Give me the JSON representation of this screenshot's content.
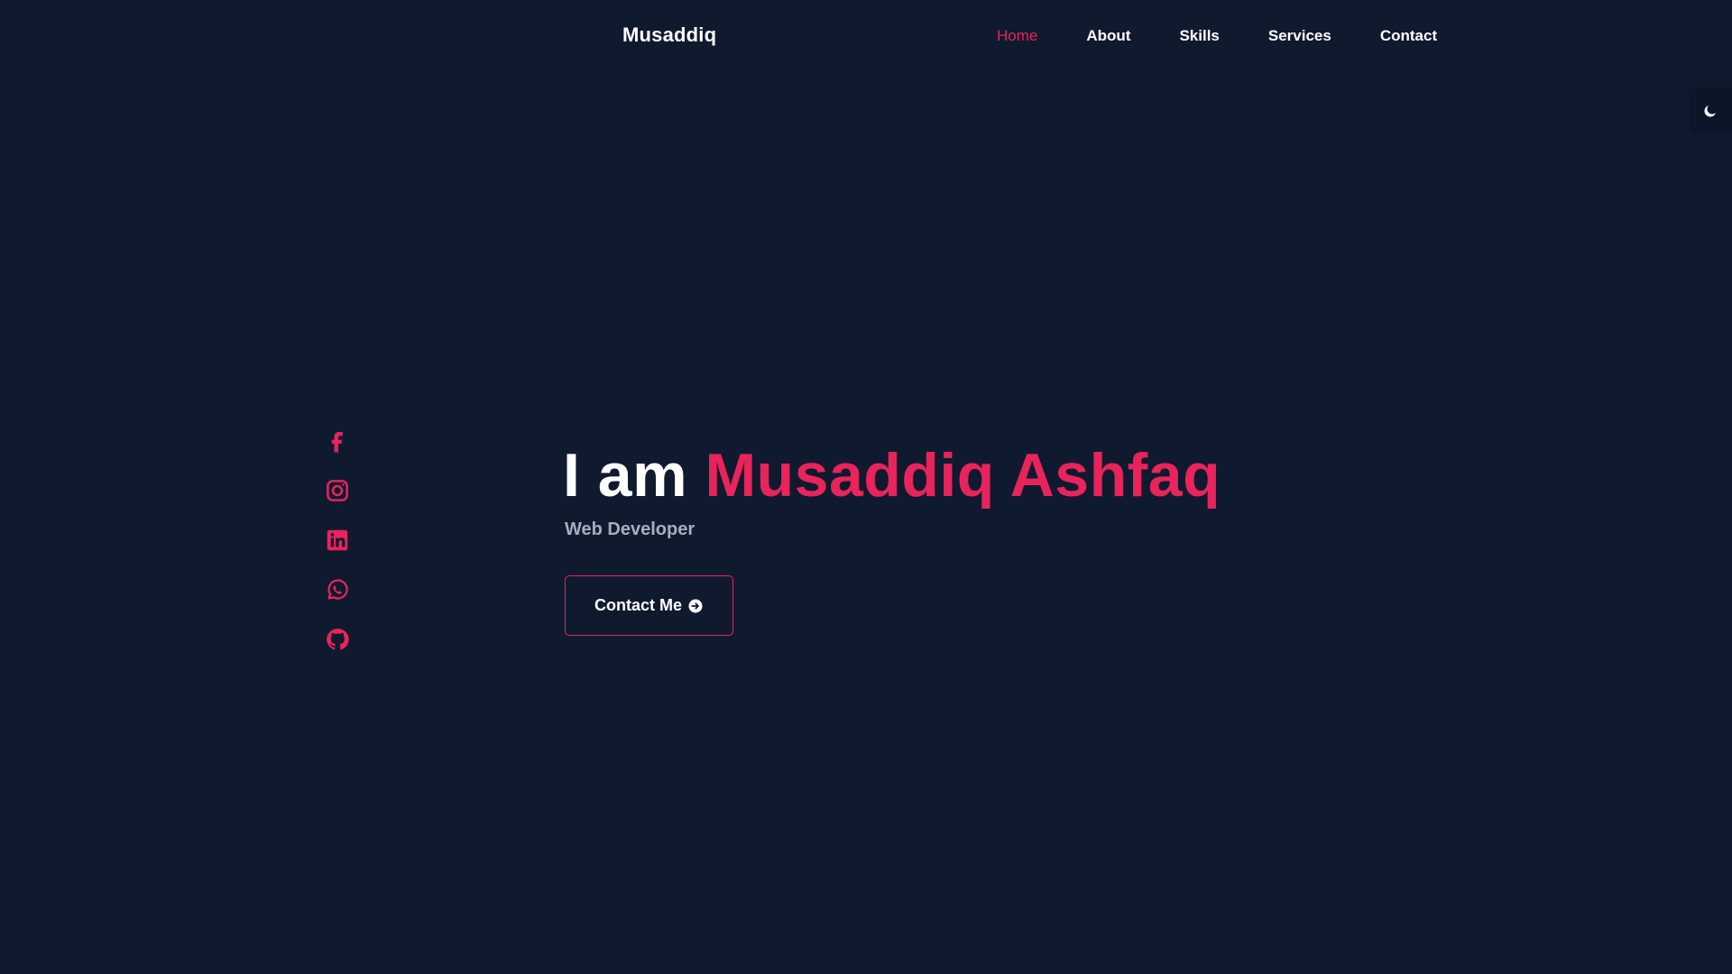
{
  "brand": {
    "logo": "Musaddiq"
  },
  "nav": {
    "items": [
      {
        "label": "Home",
        "active": true
      },
      {
        "label": "About"
      },
      {
        "label": "Skills"
      },
      {
        "label": "Services"
      },
      {
        "label": "Contact"
      }
    ]
  },
  "theme_toggle": {
    "icon": "moon-icon"
  },
  "social": [
    {
      "icon": "facebook-icon"
    },
    {
      "icon": "instagram-icon"
    },
    {
      "icon": "linkedin-icon"
    },
    {
      "icon": "whatsapp-icon"
    },
    {
      "icon": "github-icon"
    }
  ],
  "hero": {
    "title_prefix": "I am",
    "name": "Musaddiq Ashfaq",
    "subtitle": "Web Developer",
    "cta_label": "Contact Me",
    "cta_icon": "arrow-circle-right-icon"
  },
  "colors": {
    "background": "#0f1a2f",
    "accent": "#e8245a",
    "text": "#ffffff",
    "muted": "#a8aebd"
  }
}
